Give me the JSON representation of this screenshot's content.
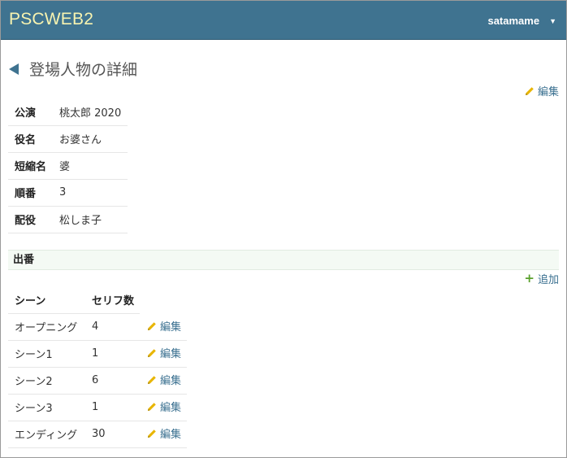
{
  "navbar": {
    "brand": "PSCWEB2",
    "user": "satamame",
    "caret": "▼"
  },
  "page": {
    "title": "登場人物の詳細",
    "edit_label": "編集"
  },
  "details": [
    {
      "key": "公演",
      "value": "桃太郎 2020"
    },
    {
      "key": "役名",
      "value": "お婆さん"
    },
    {
      "key": "短縮名",
      "value": "婆"
    },
    {
      "key": "順番",
      "value": "3"
    },
    {
      "key": "配役",
      "value": "松しま子"
    }
  ],
  "appearances": {
    "section_title": "出番",
    "add_label": "追加",
    "columns": [
      "シーン",
      "セリフ数"
    ],
    "rows": [
      {
        "scene": "オープニング",
        "lines": "4",
        "edit": "編集"
      },
      {
        "scene": "シーン1",
        "lines": "1",
        "edit": "編集"
      },
      {
        "scene": "シーン2",
        "lines": "6",
        "edit": "編集"
      },
      {
        "scene": "シーン3",
        "lines": "1",
        "edit": "編集"
      },
      {
        "scene": "エンディング",
        "lines": "30",
        "edit": "編集"
      }
    ]
  },
  "colors": {
    "navbar": "#3f7390",
    "brand_text": "#f7f3b0",
    "link": "#3a7090",
    "pencil": "#e8b500",
    "plus": "#5aa02c"
  },
  "icons": {
    "back": "back-arrow-icon",
    "pencil": "pencil-icon",
    "plus": "plus-icon",
    "caret": "caret-down-icon"
  }
}
